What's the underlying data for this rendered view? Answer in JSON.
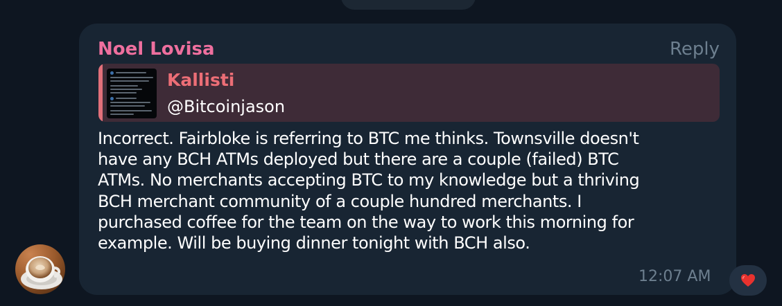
{
  "message": {
    "sender_name": "Noel Lovisa",
    "reply_label": "Reply",
    "quoted": {
      "title": "Kallisti",
      "text": "@Bitcoinjason"
    },
    "body_lines": [
      "Incorrect. Fairbloke is referring to BTC me thinks. Townsville doesn't",
      "have any BCH ATMs deployed but there are a couple (failed) BTC",
      "ATMs. No merchants accepting BTC to my knowledge but a thriving",
      "BCH merchant community of a couple hundred merchants. I",
      "purchased coffee for the team on the way to work this morning for",
      "example. Will be buying dinner tonight with BCH also."
    ],
    "time": "12:07 AM",
    "reaction_icon": "red-heart-icon"
  },
  "colors": {
    "background": "#0e1621",
    "bubble": "#182533",
    "sender_name": "#ee6f9e",
    "quote_accent": "#e2707a",
    "quote_background": "#3e2b37",
    "muted_text": "#6d7f8f",
    "reaction_heart": "#e8322e"
  }
}
